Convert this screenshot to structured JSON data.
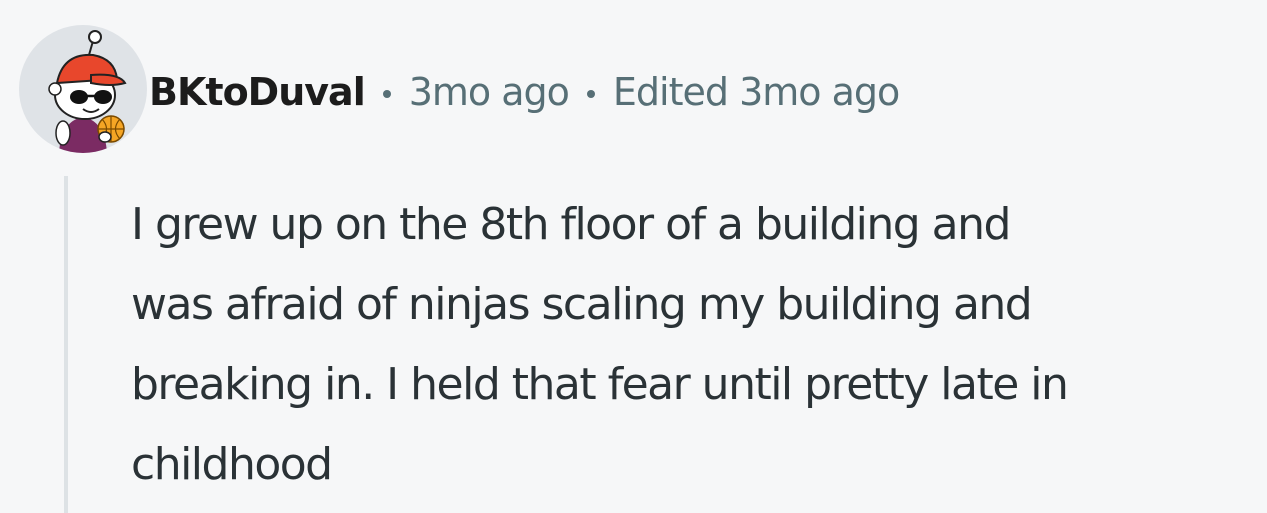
{
  "comment": {
    "author": "BKtoDuval",
    "posted_time": "3mo ago",
    "edited_label": "Edited 3mo ago",
    "body_lines": [
      "I grew up on the 8th floor of a building and",
      "was afraid of ninjas scaling my building and",
      "breaking in. I held that fear until pretty late in",
      "childhood"
    ]
  },
  "colors": {
    "background": "#f6f7f8",
    "meta_text": "#576f76",
    "thread_line": "#dde2e5",
    "cap_red": "#e8472c",
    "ball_orange": "#f5a524"
  },
  "icons": {
    "avatar": "snoo-avatar-red-cap-sunglasses-basketball"
  }
}
